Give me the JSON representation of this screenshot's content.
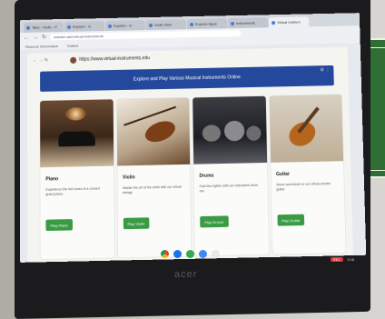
{
  "browser": {
    "tabs": [
      {
        "label": "Tabs - Violin - P"
      },
      {
        "label": "Explore - G"
      },
      {
        "label": "Explore - G"
      },
      {
        "label": "Violin Strin"
      },
      {
        "label": "Explore Apps"
      },
      {
        "label": "Instruments"
      },
      {
        "label": "Virtual Instrum",
        "active": true
      }
    ],
    "url": "websim.ai/c/virtual-instruments",
    "bookmarks": [
      "Resume Information",
      "Dotted"
    ]
  },
  "site": {
    "url": "https://www.virtual-instruments.edu",
    "header_title": "Explore and Play Various Musical Instruments Online"
  },
  "cards": [
    {
      "title": "Piano",
      "description": "Experience the rich tones of a concert grand piano.",
      "button": "Play Piano",
      "image": "piano"
    },
    {
      "title": "Violin",
      "description": "Master the art of the violin with our virtual strings.",
      "button": "Play Violin",
      "image": "violin"
    },
    {
      "title": "Drums",
      "description": "Feel the rhythm with our interactive drum set.",
      "button": "Play Drums",
      "image": "drums"
    },
    {
      "title": "Guitar",
      "description": "Strum and shred on our virtual electric guitar.",
      "button": "Play Guitar",
      "image": "guitar"
    }
  ],
  "shelf_icons": [
    "chrome-icon",
    "files-icon",
    "play-store-icon",
    "docs-icon",
    "account-icon"
  ],
  "tray": {
    "rec": "REC",
    "time": "3:08"
  },
  "laptop_brand": "acer"
}
